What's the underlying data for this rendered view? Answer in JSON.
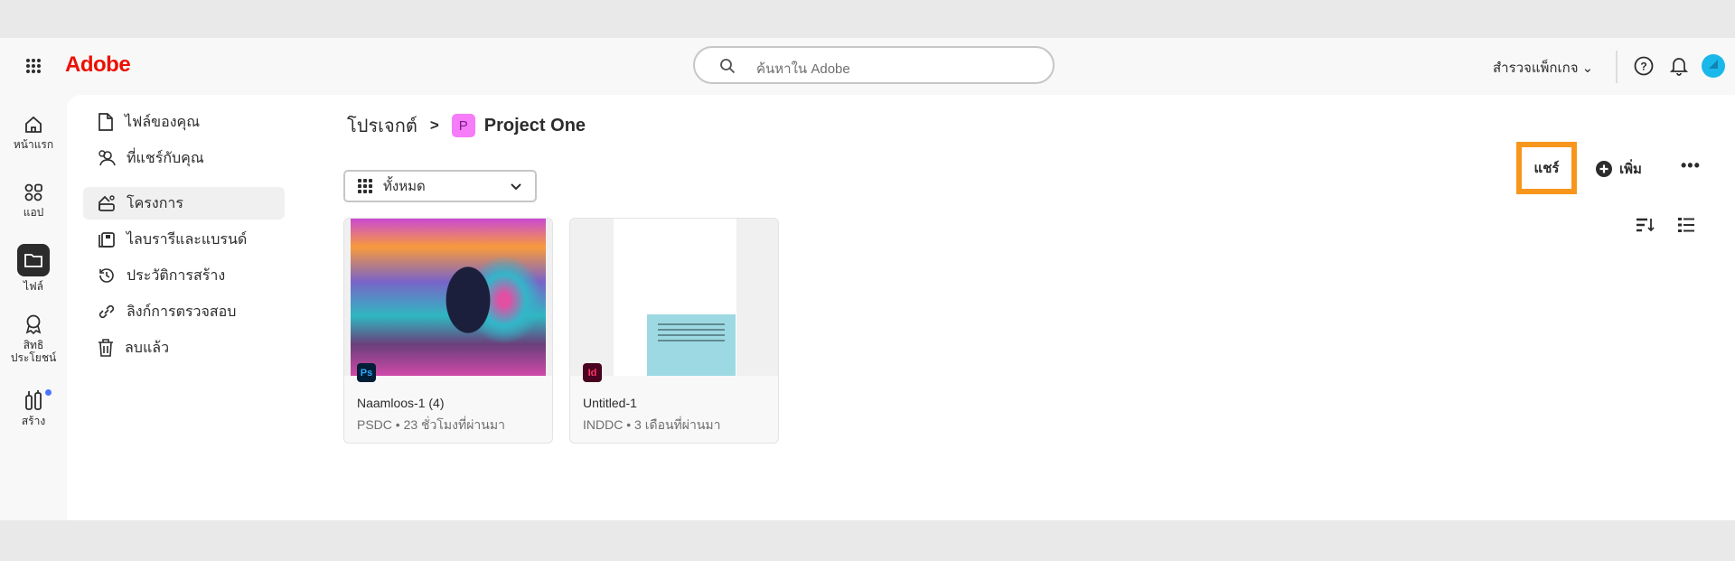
{
  "header": {
    "brand": "Adobe",
    "search_placeholder": "ค้นหาใน Adobe",
    "explore": "สำรวจแพ็กเกจ"
  },
  "rail": [
    {
      "label": "หน้าแรก"
    },
    {
      "label": "แอป"
    },
    {
      "label": "ไฟล์"
    },
    {
      "label": "สิทธิ ประโยชน์"
    },
    {
      "label": "สร้าง"
    }
  ],
  "nav": [
    {
      "label": "ไฟล์ของคุณ"
    },
    {
      "label": "ที่แชร์กับคุณ"
    },
    {
      "label": "โครงการ"
    },
    {
      "label": "ไลบรารีและแบรนด์"
    },
    {
      "label": "ประวัติการสร้าง"
    },
    {
      "label": "ลิงก์การตรวจสอบ"
    },
    {
      "label": "ลบแล้ว"
    }
  ],
  "breadcrumb": {
    "parent": "โปรเจกต์",
    "separator": ">",
    "badge": "P",
    "title": "Project One"
  },
  "filter": {
    "selected": "ทั้งหมด"
  },
  "actions": {
    "share": "แชร์",
    "add": "เพิ่ม",
    "more": "•••"
  },
  "files": [
    {
      "name": "Naamloos-1 (4)",
      "meta": "PSDC • 23 ชั่วโมงที่ผ่านมา",
      "app": "Ps"
    },
    {
      "name": "Untitled-1",
      "meta": "INDDC • 3 เดือนที่ผ่านมา",
      "app": "Id"
    }
  ],
  "colors": {
    "brand": "#eb1000",
    "highlight": "#f7961c",
    "project_badge": "#f67cf9"
  }
}
